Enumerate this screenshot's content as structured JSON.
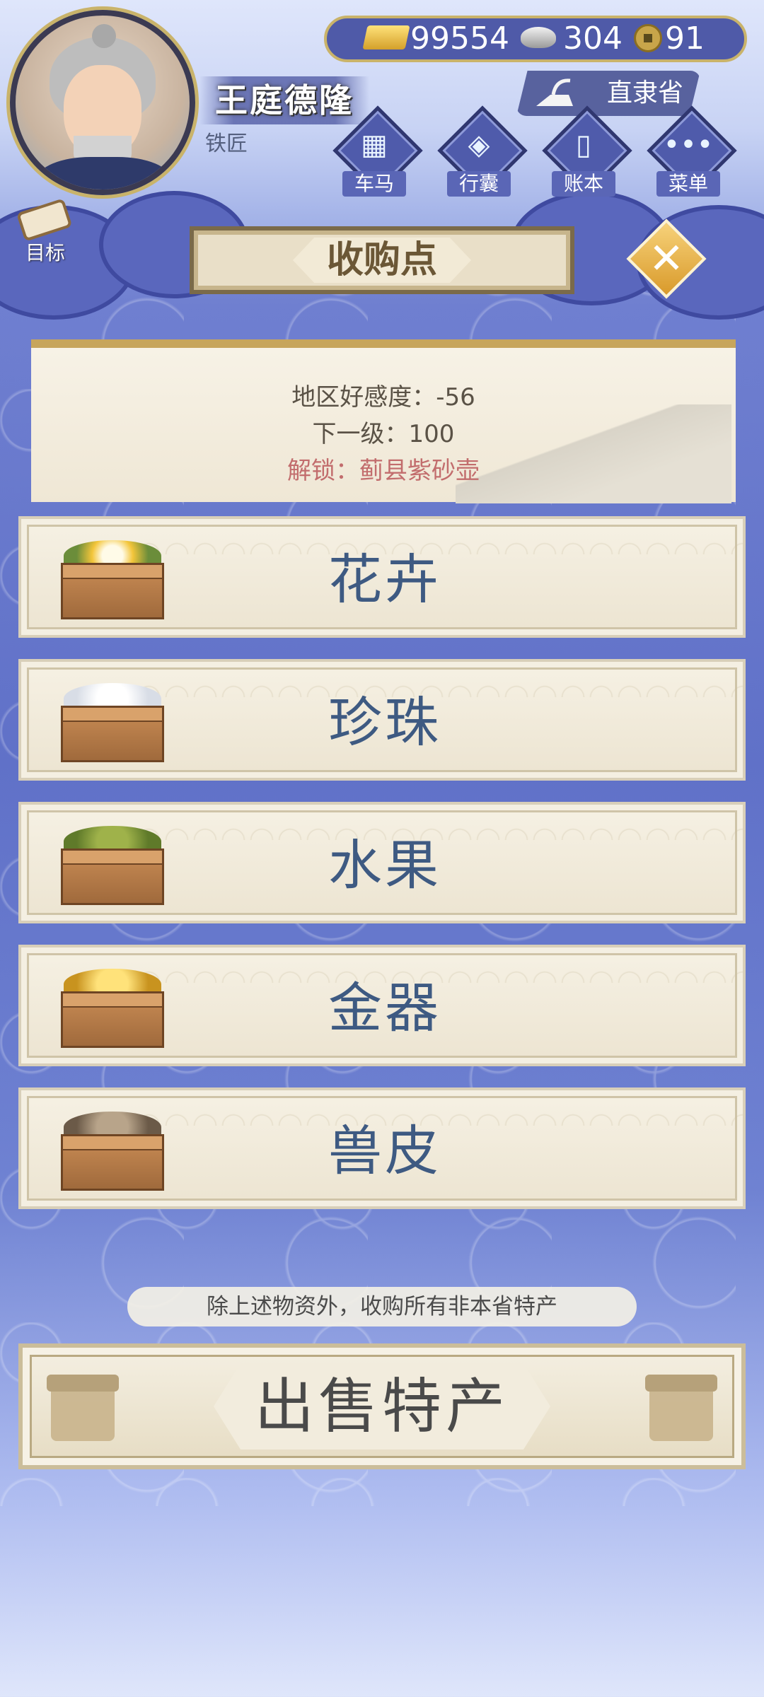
{
  "player": {
    "name": "王庭德隆",
    "title": "铁匠"
  },
  "currency": {
    "gold": "99554",
    "silver": "304",
    "coins": "91"
  },
  "location": {
    "province": "直隶省"
  },
  "menu": [
    {
      "label": "车马",
      "icon": "carriage-icon"
    },
    {
      "label": "行囊",
      "icon": "bundle-icon"
    },
    {
      "label": "账本",
      "icon": "ledger-icon"
    },
    {
      "label": "菜单",
      "icon": "more-icon"
    }
  ],
  "goal": {
    "label": "目标"
  },
  "screen_title": "收购点",
  "info": {
    "favor": "地区好感度：-56",
    "next_level": "下一级：100",
    "unlock": "解锁：蓟县紫砂壶"
  },
  "categories": [
    {
      "label": "花卉",
      "icon": "flowers-crate-icon"
    },
    {
      "label": "珍珠",
      "icon": "pearls-crate-icon"
    },
    {
      "label": "水果",
      "icon": "fruit-crate-icon"
    },
    {
      "label": "金器",
      "icon": "gold-items-crate-icon"
    },
    {
      "label": "兽皮",
      "icon": "hides-crate-icon"
    }
  ],
  "notice": "除上述物资外，收购所有非本省特产",
  "sell_button": "出售特产",
  "colors": {
    "accent_blue": "#3e5a82",
    "gold": "#c9b36a",
    "bg_blue": "#6071c8"
  }
}
